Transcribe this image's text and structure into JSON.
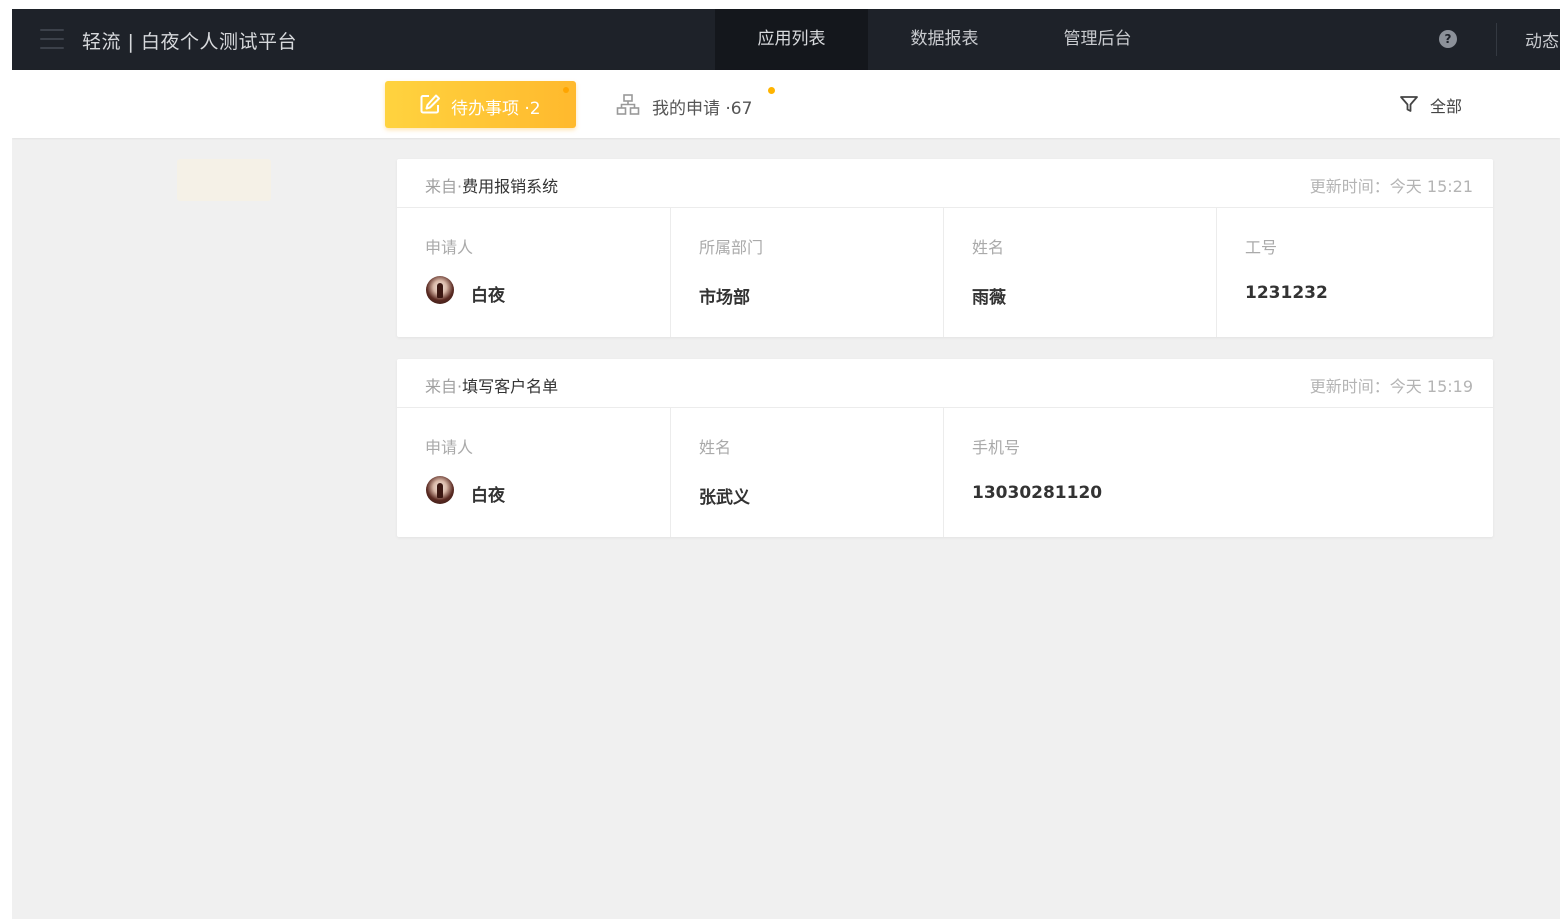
{
  "topbar": {
    "app_title": "轻流 | 白夜个人测试平台",
    "nav": [
      "应用列表",
      "数据报表",
      "管理后台"
    ],
    "active_nav": "应用列表",
    "help_icon": "?",
    "dynamic_label": "动态"
  },
  "subbar": {
    "todo_label": "待办事项 ·2",
    "mine_label": "我的申请 ·67",
    "filter_label": "全部"
  },
  "colors": {
    "topbar_bg": "#1e2229",
    "accent": "#ffc233",
    "page_bg": "#f0f0f0"
  },
  "cards": [
    {
      "from_prefix": "来自·",
      "from_name": "费用报销系统",
      "time": "更新时间：今天 15:21",
      "applicant_label": "申请人",
      "applicant_name": "白夜",
      "fields": [
        {
          "label": "所属部门",
          "value": "市场部"
        },
        {
          "label": "姓名",
          "value": "雨薇"
        },
        {
          "label": "工号",
          "value": "1231232"
        }
      ]
    },
    {
      "from_prefix": "来自·",
      "from_name": "填写客户名单",
      "time": "更新时间：今天 15:19",
      "applicant_label": "申请人",
      "applicant_name": "白夜",
      "fields": [
        {
          "label": "姓名",
          "value": "张武义"
        },
        {
          "label": "手机号",
          "value": "13030281120"
        }
      ]
    }
  ]
}
